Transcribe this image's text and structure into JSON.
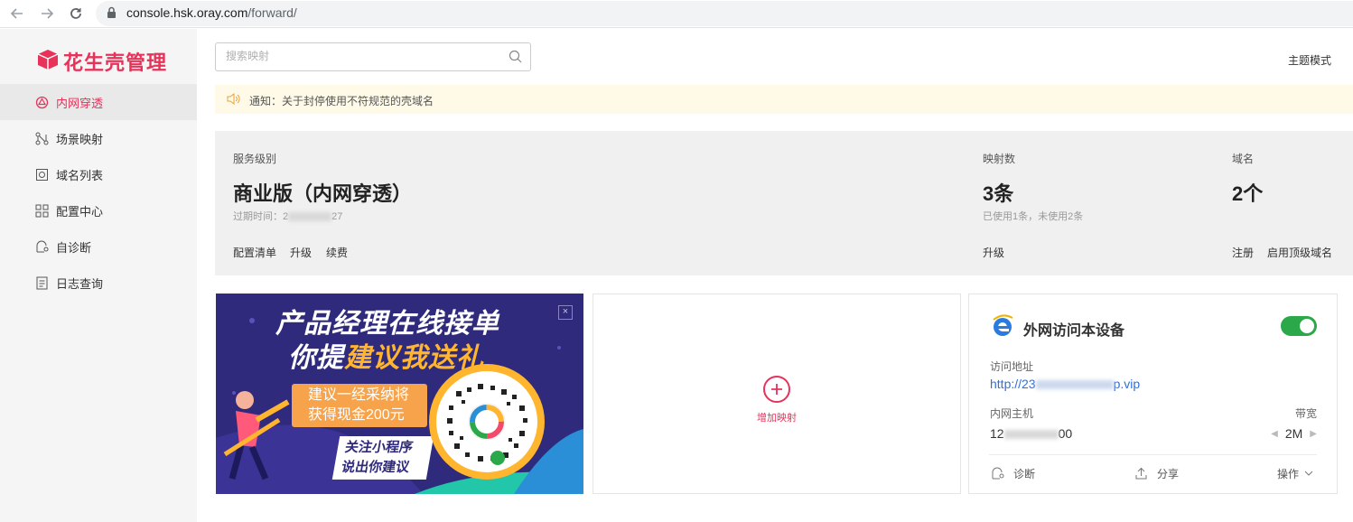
{
  "browser": {
    "url_host": "console.hsk.oray.com",
    "url_path": "/forward/"
  },
  "sidebar": {
    "logo": "花生壳管理",
    "items": [
      {
        "label": "内网穿透",
        "icon": "network-penetration-icon",
        "active": true
      },
      {
        "label": "场景映射",
        "icon": "scene-mapping-icon",
        "active": false
      },
      {
        "label": "域名列表",
        "icon": "domain-list-icon",
        "active": false
      },
      {
        "label": "配置中心",
        "icon": "config-grid-icon",
        "active": false
      },
      {
        "label": "自诊断",
        "icon": "diagnose-icon",
        "active": false
      },
      {
        "label": "日志查询",
        "icon": "log-document-icon",
        "active": false
      }
    ]
  },
  "header": {
    "search_placeholder": "搜索映射",
    "theme_label": "主题模式"
  },
  "notice": {
    "text": "通知：关于封停使用不符规范的壳域名"
  },
  "stats": {
    "service": {
      "label": "服务级别",
      "value": "商业版（内网穿透）",
      "expire_prefix": "过期时间：2",
      "expire_suffix": "27",
      "links": [
        "配置清单",
        "升级",
        "续费"
      ]
    },
    "mappings": {
      "label": "映射数",
      "value": "3条",
      "sub": "已使用1条，未使用2条",
      "link": "升级"
    },
    "domains": {
      "label": "域名",
      "value": "2个",
      "links": [
        "注册",
        "启用顶级域名"
      ]
    }
  },
  "banner": {
    "line1": "产品经理在线接单",
    "line2_a": "你提",
    "line2_b": "建议我送礼",
    "tag_line1": "建议一经采纳将",
    "tag_line2": "获得现金200元",
    "tag2_line1": "关注小程序",
    "tag2_line2": "说出你建议",
    "close": "×"
  },
  "add_card": {
    "label": "增加映射"
  },
  "device_card": {
    "title": "外网访问本设备",
    "toggle_on": true,
    "access_label": "访问地址",
    "url_prefix": "http://23",
    "url_suffix": "p.vip",
    "host_label": "内网主机",
    "host_prefix": "12",
    "host_suffix": "00",
    "bw_label": "带宽",
    "bw_value": "2M",
    "actions": {
      "diagnose": "诊断",
      "share": "分享",
      "operate": "操作"
    }
  },
  "colors": {
    "brand": "#e8325a",
    "link": "#2f6fd9",
    "toggle": "#2ba84a",
    "notice_bg": "#fffae8"
  }
}
